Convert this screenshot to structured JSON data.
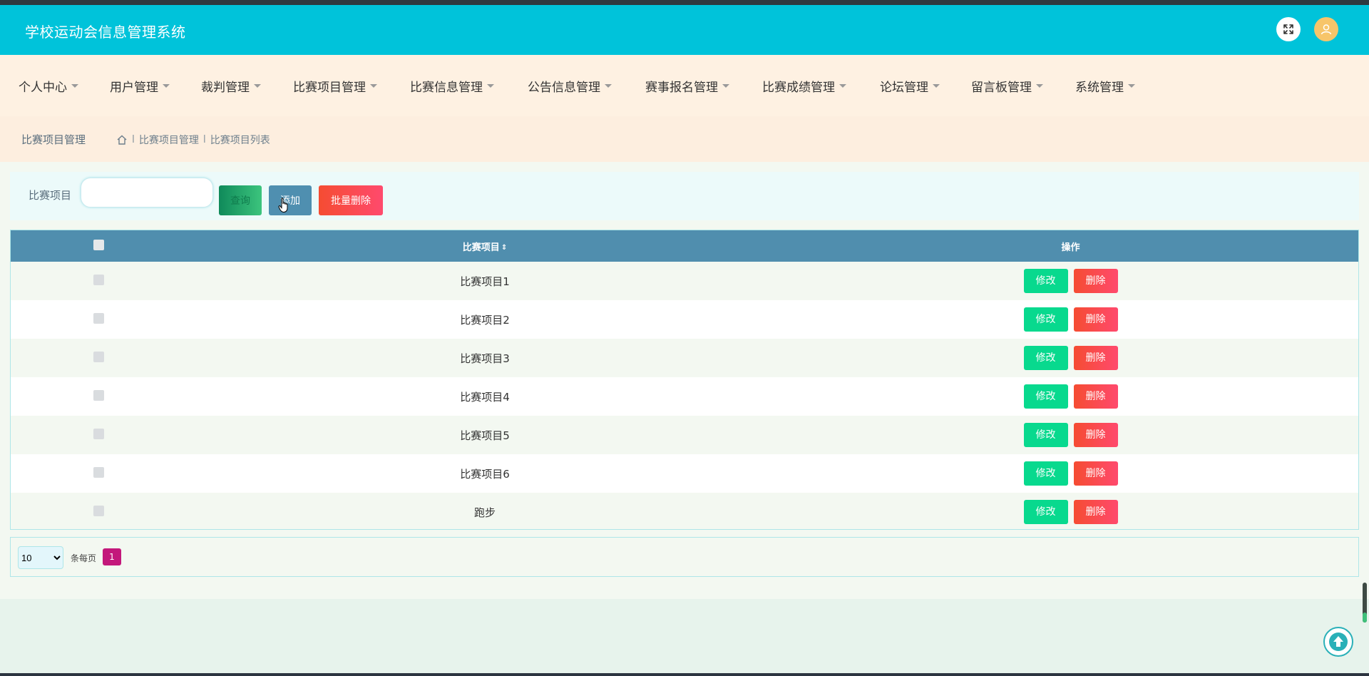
{
  "app": {
    "title": "学校运动会信息管理系统"
  },
  "header": {
    "fullscreen_icon": "expand-arrows-icon",
    "user_icon": "user-icon"
  },
  "nav": {
    "items": [
      {
        "label": "个人中心"
      },
      {
        "label": "用户管理"
      },
      {
        "label": "裁判管理"
      },
      {
        "label": "比赛项目管理"
      },
      {
        "label": "比赛信息管理"
      },
      {
        "label": "公告信息管理"
      },
      {
        "label": "赛事报名管理"
      },
      {
        "label": "比赛成绩管理"
      },
      {
        "label": "论坛管理"
      },
      {
        "label": "留言板管理"
      },
      {
        "label": "系统管理"
      }
    ]
  },
  "breadcrumb": {
    "title": "比赛项目管理",
    "path": [
      "比赛项目管理",
      "比赛项目列表"
    ],
    "separator": "l"
  },
  "search": {
    "label": "比赛项目",
    "value": "",
    "placeholder": "",
    "search_button": "查询",
    "add_button": "添加",
    "batch_delete_button": "批量删除"
  },
  "table": {
    "columns": {
      "name": "比赛项目",
      "actions": "操作"
    },
    "edit_label": "修改",
    "delete_label": "删除",
    "rows": [
      {
        "name": "比赛项目1"
      },
      {
        "name": "比赛项目2"
      },
      {
        "name": "比赛项目3"
      },
      {
        "name": "比赛项目4"
      },
      {
        "name": "比赛项目5"
      },
      {
        "name": "比赛项目6"
      },
      {
        "name": "跑步"
      }
    ]
  },
  "pagination": {
    "page_size": "10",
    "page_size_options": [
      "10"
    ],
    "per_page_label": "条每页",
    "current_page": "1"
  },
  "colors": {
    "header": "#00c3da",
    "nav_bg": "#fef1e2",
    "table_header": "#508eae",
    "edit": "#08d98e",
    "delete": "#ff4a6d",
    "page_active": "#c3187b"
  }
}
